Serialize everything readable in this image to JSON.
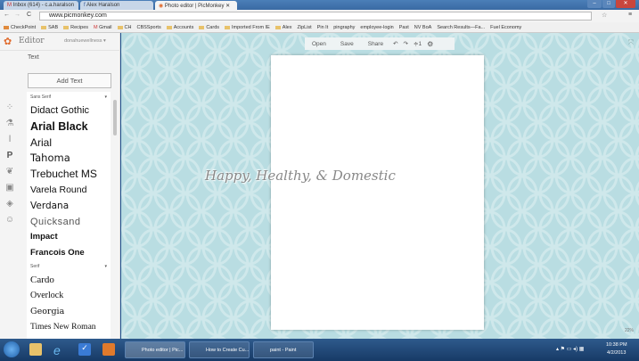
{
  "browser": {
    "tabs": [
      {
        "label": "Inbox (614) - c.a.haralson"
      },
      {
        "label": "Alex Haralson"
      },
      {
        "label": "Photo editor | PicMonkey"
      }
    ],
    "url": "www.picmonkey.com",
    "bookmarks": [
      "CheckPoint",
      "SAB",
      "Recipes",
      "Gmail",
      "CH",
      "CBSSports",
      "Accounts",
      "Cards",
      "Imported From IE",
      "Alex",
      "ZipList",
      "Pin It",
      "pingraphy",
      "employee-login",
      "Past",
      "NV BoA",
      "Search Results—Fa...",
      "Fuel Economy"
    ]
  },
  "sidebar": {
    "logo": "Editor",
    "user": "donahuewellness ▾",
    "section": "Text",
    "add_text": "Add Text",
    "cat1": "Sans Serif",
    "sans_fonts": [
      "Didact Gothic",
      "Arial Black",
      "Arial",
      "Tahoma",
      "Trebuchet MS",
      "Varela Round",
      "Verdana",
      "Quicksand",
      "Impact",
      "Francois One"
    ],
    "cat2": "Serif",
    "serif_fonts": [
      "Cardo",
      "Overlock",
      "Georgia",
      "Times New Roman"
    ]
  },
  "toolbar": {
    "open": "Open",
    "save": "Save",
    "share": "Share",
    "layers": "≑1"
  },
  "canvas": {
    "watermark": "Happy, Healthy, & Domestic",
    "zoom": "22%"
  },
  "taskbar": {
    "items": [
      "Photo editor | Pic...",
      "How to Create Cu...",
      "paint - Paint"
    ],
    "time": "10:38 PM",
    "date": "4/2/2013"
  },
  "colors": {
    "bg": "#b9dde2",
    "accent": "#e06a2c"
  }
}
